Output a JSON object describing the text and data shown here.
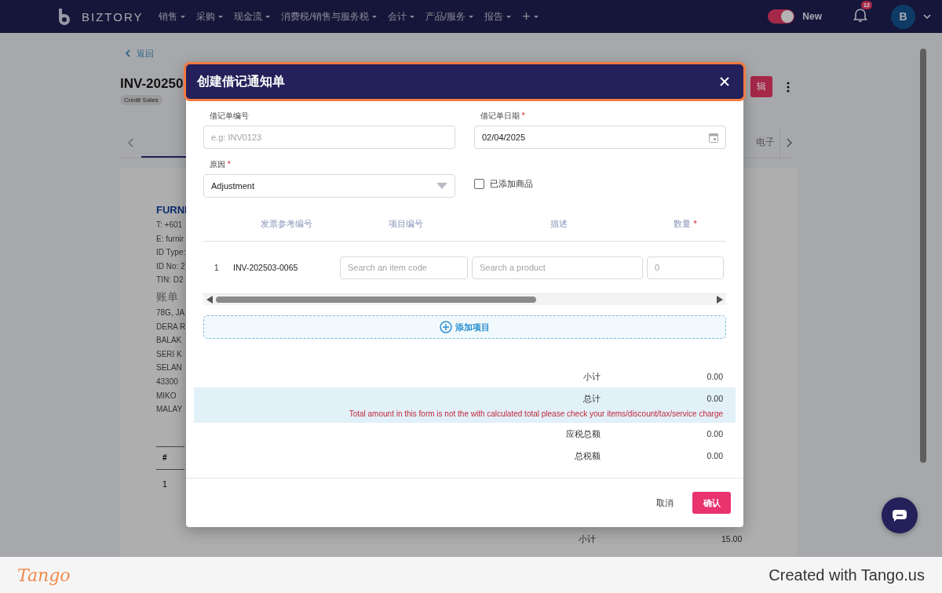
{
  "nav": {
    "logo": "BIZTORY",
    "menus": [
      {
        "label": "销售"
      },
      {
        "label": "采购"
      },
      {
        "label": "现金流"
      },
      {
        "label": "消费税/销售与服务税"
      },
      {
        "label": "会计"
      },
      {
        "label": "产品/服务"
      },
      {
        "label": "报告"
      }
    ],
    "plus": "+",
    "toggle": {
      "label": "New",
      "on": true
    },
    "notification_count": "12",
    "avatar": "B"
  },
  "page": {
    "back": "返回",
    "title": "INV-20250",
    "tag": "Credit Sales",
    "edit_button": "辑",
    "tabs": [
      {
        "label": "电子"
      }
    ],
    "card": {
      "company": "FURNI",
      "lines": [
        "T: +601",
        "E: furnir",
        "ID Type:",
        "ID No: 2",
        "TIN: D2"
      ],
      "bill_to": "账单",
      "address": [
        "78G, JA",
        "DERA R",
        "BALAK",
        "SERI K",
        "SELAN",
        "43300",
        "MIKO",
        "MALAY"
      ],
      "table_head": "#",
      "row_no": "1",
      "subtotal_label": "小计",
      "subtotal": "15.00"
    }
  },
  "modal": {
    "title": "创建借记通知单",
    "number": {
      "label": "借记单编号",
      "placeholder": "e.g: INV0123"
    },
    "date": {
      "label": "借记单日期",
      "required_mark": "*",
      "value": "02/04/2025"
    },
    "reason": {
      "label": "原因",
      "required_mark": "*",
      "value": "Adjustment"
    },
    "added_goods": {
      "label": "已添加商品",
      "checked": false
    },
    "columns": [
      {
        "label": "发票参考编号"
      },
      {
        "label": "项目编号"
      },
      {
        "label": "描述"
      },
      {
        "label": "数量",
        "required_mark": "*"
      }
    ],
    "rows": [
      {
        "no": "1",
        "invoice": "INV-202503-0065",
        "item_placeholder": "Search an item code",
        "product_placeholder": "Search a product",
        "qty_placeholder": "0"
      }
    ],
    "add_item": "添加项目",
    "totals": [
      {
        "label": "小计",
        "value": "0.00",
        "highlighted": false
      },
      {
        "label": "总计",
        "value": "0.00",
        "highlighted": true,
        "warning": "Total amount in this form is not the with calculated total please check your items/discount/tax/service charge"
      },
      {
        "label": "应税总额",
        "value": "0.00",
        "highlighted": false
      },
      {
        "label": "总税额",
        "value": "0.00",
        "highlighted": false
      }
    ],
    "cancel": "取消",
    "confirm": "确认"
  },
  "footer": {
    "brand": "Tango",
    "credit": "Created with Tango.us"
  }
}
